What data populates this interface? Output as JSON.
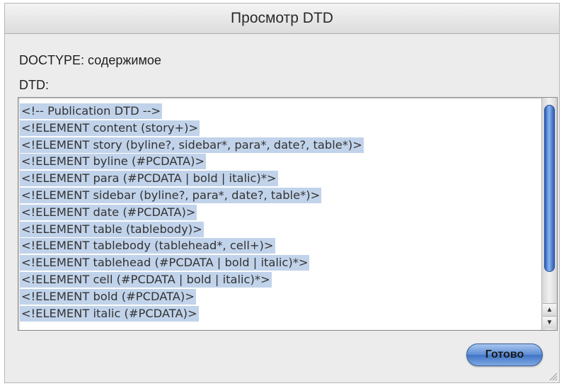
{
  "window": {
    "title": "Просмотр DTD"
  },
  "doctype": {
    "label": "DOCTYPE: содержимое"
  },
  "dtd": {
    "label": "DTD:",
    "lines": [
      "<!-- Publication DTD -->",
      "<!ELEMENT content (story+)>",
      "<!ELEMENT story (byline?, sidebar*, para*, date?, table*)>",
      "<!ELEMENT byline (#PCDATA)>",
      "<!ELEMENT para (#PCDATA | bold | italic)*>",
      "<!ELEMENT sidebar (byline?, para*, date?, table*)>",
      "<!ELEMENT date (#PCDATA)>",
      "<!ELEMENT table (tablebody)>",
      "<!ELEMENT tablebody (tablehead*, cell+)>",
      "<!ELEMENT tablehead (#PCDATA | bold | italic)*>",
      "<!ELEMENT cell (#PCDATA | bold | italic)*>",
      "<!ELEMENT bold (#PCDATA)>",
      "<!ELEMENT italic (#PCDATA)>"
    ],
    "selection_color": "#c1d3ea"
  },
  "scrollbar": {
    "up_icon": "triangle-up",
    "down_icon": "triangle-down",
    "accent": "#2c5db8"
  },
  "buttons": {
    "done_label": "Готово"
  }
}
